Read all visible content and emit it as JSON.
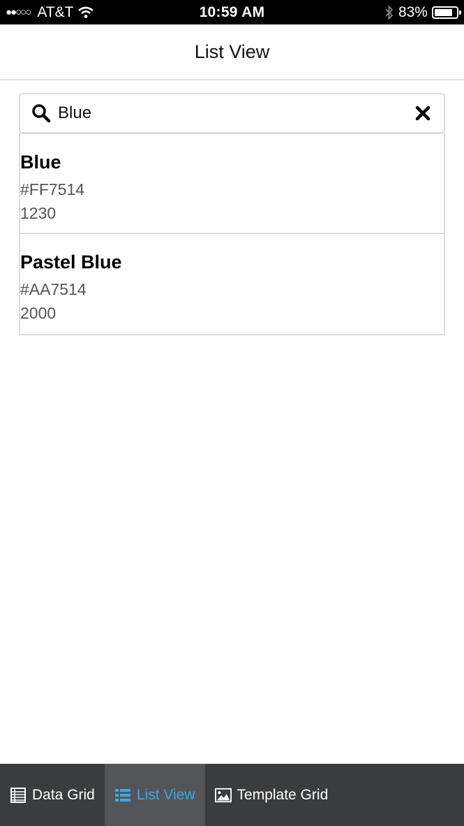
{
  "status_bar": {
    "signal": "●●○○○",
    "carrier": "AT&T",
    "time": "10:59 AM",
    "battery_percent": "83%",
    "battery_level": 0.83
  },
  "header": {
    "title": "List View"
  },
  "search": {
    "value": "Blue",
    "placeholder": ""
  },
  "items": [
    {
      "name": "Blue",
      "code": "#FF7514",
      "number": "1230"
    },
    {
      "name": "Pastel Blue",
      "code": "#AA7514",
      "number": "2000"
    }
  ],
  "tabs": [
    {
      "label": "Data Grid",
      "icon": "data-grid-icon",
      "active": false
    },
    {
      "label": "List View",
      "icon": "list-view-icon",
      "active": true
    },
    {
      "label": "Template Grid",
      "icon": "image-icon",
      "active": false
    }
  ],
  "colors": {
    "accent": "#3fa9e0",
    "tab_bar": "#3b3c3d",
    "tab_active_bg": "#535558"
  }
}
